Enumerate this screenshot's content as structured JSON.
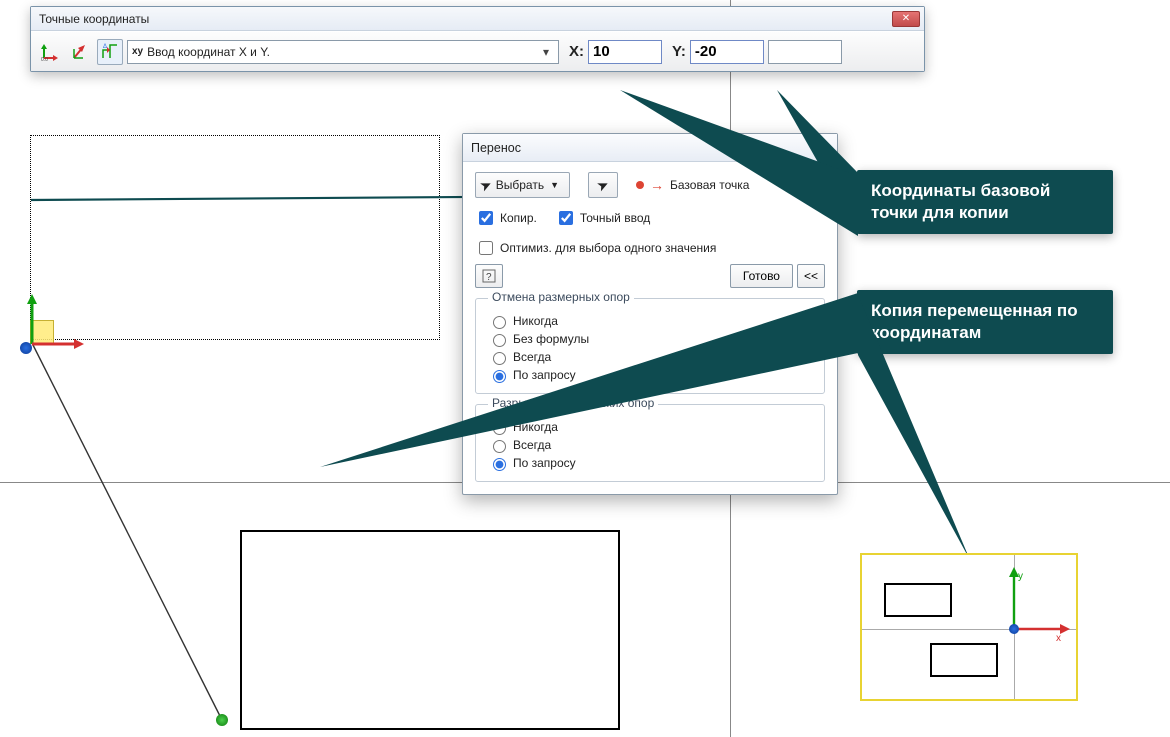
{
  "toolbar": {
    "window_title": "Точные координаты",
    "combo_prefix": "xy",
    "combo_text": "Ввод координат X и Y.",
    "x_label": "X:",
    "x_value": "10",
    "y_label": "Y:",
    "y_value": "-20"
  },
  "dialog": {
    "title": "Перенос",
    "select_btn": "Выбрать",
    "base_point_label": "Базовая точка",
    "chk_copy": "Копир.",
    "chk_precise": "Точный ввод",
    "chk_optimize": "Оптимиз. для выбора одного значения",
    "done_btn": "Готово",
    "collapse_btn": "<<",
    "group1_title": "Отмена размерных опор",
    "group1_options": [
      "Никогда",
      "Без формулы",
      "Всегда",
      "По запросу"
    ],
    "group1_selected": 3,
    "group2_title": "Разрыв геометрических опор",
    "group2_options": [
      "Никогда",
      "Всегда",
      "По запросу"
    ],
    "group2_selected": 2
  },
  "callouts": {
    "c1": "Координаты базовой точки для копии",
    "c2": "Копия перемещенная по координатам"
  }
}
